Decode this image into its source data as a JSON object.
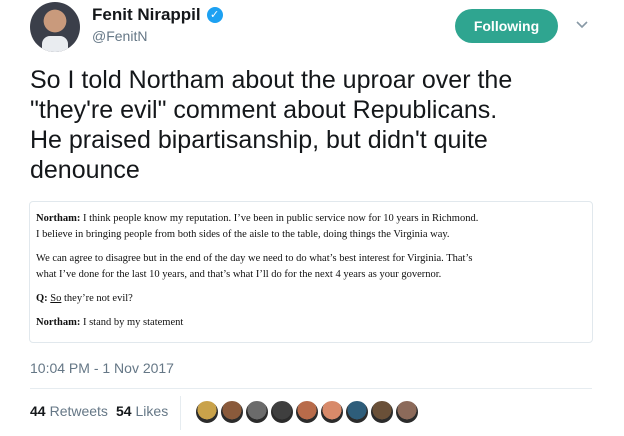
{
  "author": {
    "display_name": "Fenit Nirappil",
    "handle": "@FenitN",
    "verified_icon": "verified-badge-icon"
  },
  "follow_button": {
    "label": "Following",
    "color": "#2fa590"
  },
  "menu_icon": "chevron-down-icon",
  "tweet": {
    "text_lines": [
      "So I told Northam about the uproar over the",
      "\"they're evil\" comment about Republicans.",
      "He praised bipartisanship, but didn't quite",
      "denounce"
    ]
  },
  "card": {
    "p1_speaker": "Northam:",
    "p1_line1": "I think people know my reputation. I’ve been in public service now for 10 years in Richmond.",
    "p1_line2": "I believe in bringing people from both sides of the aisle to the table, doing things the Virginia way.",
    "p2_line1": "We can agree to disagree but in the end of the day we need to do what’s best interest for Virginia. That’s",
    "p2_line2": "what I’ve done for the last 10 years, and that’s what I’ll do for the next 4 years as your governor.",
    "q_label": "Q:",
    "q_underlined": "So",
    "q_rest": "they’re not evil?",
    "a_speaker": "Northam:",
    "a_text": "I stand by my statement"
  },
  "timestamp": "10:04 PM - 1 Nov 2017",
  "stats": {
    "retweets_count": "44",
    "retweets_label": "Retweets",
    "likes_count": "54",
    "likes_label": "Likes"
  },
  "likers": [
    "#c9a24a",
    "#8a5a3b",
    "#6b6b6b",
    "#3f3f3f",
    "#b86b4a",
    "#d88a6a",
    "#2e5d7a",
    "#6a5038",
    "#8c6a5a"
  ]
}
